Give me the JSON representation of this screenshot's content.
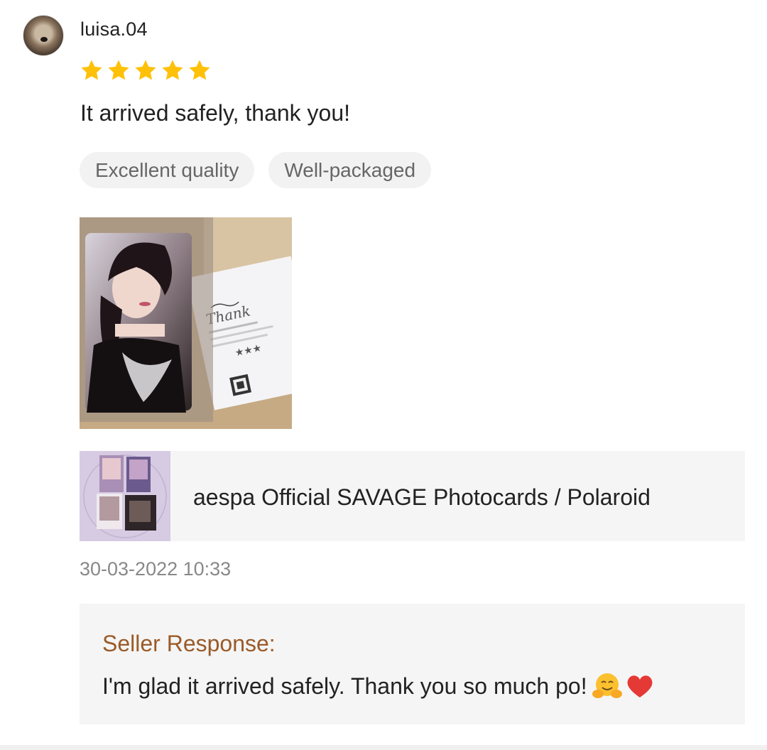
{
  "review": {
    "username": "luisa.04",
    "rating": 5,
    "rating_max": 5,
    "text": "It arrived safely, thank you!",
    "tags": [
      "Excellent quality",
      "Well-packaged"
    ],
    "date": "30-03-2022 10:33"
  },
  "product": {
    "title": "aespa Official SAVAGE Photocards / Polaroid"
  },
  "seller_response": {
    "label": "Seller Response:",
    "text": "I'm glad it arrived safely. Thank you so much po!"
  },
  "colors": {
    "star": "#ffc107",
    "seller_label": "#9a5b29",
    "tag_bg": "#f2f2f2",
    "panel_bg": "#f5f5f5"
  },
  "icons": {
    "star": "star-icon",
    "emoji_1": "hugging-face-emoji",
    "emoji_2": "red-heart-emoji"
  }
}
